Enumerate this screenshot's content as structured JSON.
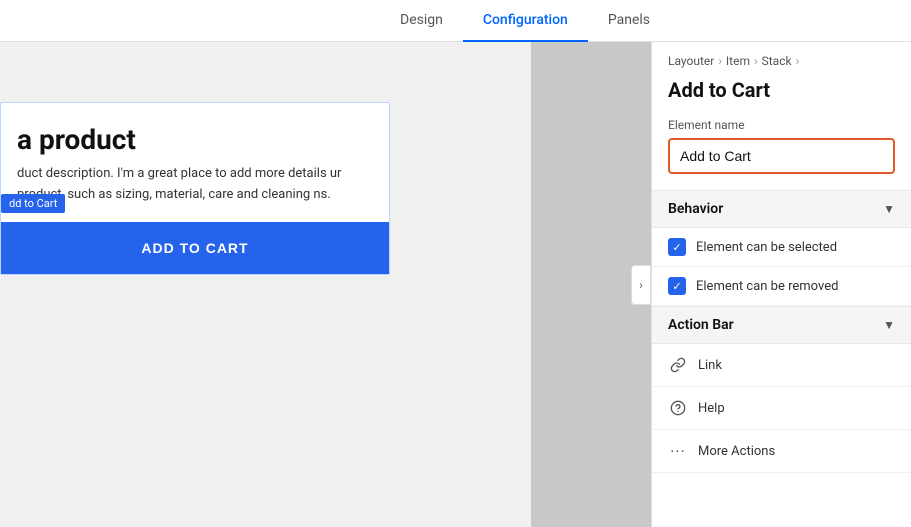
{
  "tabs": {
    "items": [
      {
        "id": "design",
        "label": "Design",
        "active": false
      },
      {
        "id": "configuration",
        "label": "Configuration",
        "active": true
      },
      {
        "id": "panels",
        "label": "Panels",
        "active": false
      }
    ]
  },
  "breadcrumb": {
    "items": [
      "Layouter",
      "Item",
      "Stack"
    ]
  },
  "panel": {
    "title": "Add to Cart",
    "element_name_label": "Element name",
    "element_name_value": "Add to Cart"
  },
  "behavior": {
    "header": "Behavior",
    "options": [
      {
        "id": "selectable",
        "label": "Element can be selected",
        "checked": true
      },
      {
        "id": "removable",
        "label": "Element can be removed",
        "checked": true
      }
    ]
  },
  "action_bar": {
    "header": "Action Bar",
    "items": [
      {
        "id": "link",
        "label": "Link",
        "icon": "🔗"
      },
      {
        "id": "help",
        "label": "Help",
        "icon": "?"
      },
      {
        "id": "more",
        "label": "More Actions",
        "icon": "···"
      }
    ]
  },
  "preview": {
    "product_title": "a product",
    "product_desc": "duct description. I'm a great place to add more details ur product, such as sizing, material, care and cleaning ns.",
    "add_to_cart_label": "dd to Cart",
    "add_to_cart_btn": "ADD TO CART",
    "collapse_icon": "›"
  }
}
